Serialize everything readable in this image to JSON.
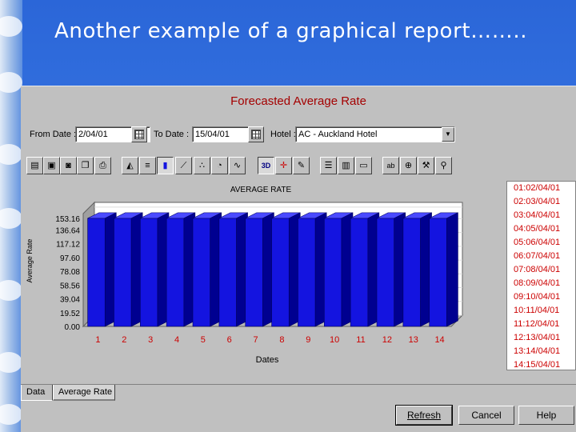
{
  "slide": {
    "title": "Another example of a graphical report…….."
  },
  "report": {
    "title": "Forecasted Average Rate",
    "from_label": "From Date :",
    "from_value": "2/04/01",
    "to_label": "To Date :",
    "to_value": "15/04/01",
    "hotel_label": "Hotel :",
    "hotel_value": "AC - Auckland Hotel"
  },
  "toolbar": {
    "icons": [
      "save-icon",
      "disk-icon",
      "camera-icon",
      "copy-icon",
      "print-icon",
      "area-chart-icon",
      "bar-horizontal-icon",
      "bar-chart-icon",
      "line-chart-icon",
      "scatter-icon",
      "pie-chart-icon",
      "trend-icon",
      "3d-icon",
      "crosshair-icon",
      "edit-points-icon",
      "text-icon",
      "columns-icon",
      "lines-icon",
      "label-icon",
      "zoom-icon",
      "tools-icon",
      "search-icon"
    ],
    "btn_3d": "3D",
    "btn_label": "ab"
  },
  "chart_data": {
    "type": "bar",
    "title": "AVERAGE RATE",
    "xlabel": "Dates",
    "ylabel": "Average Rate",
    "categories": [
      "1",
      "2",
      "3",
      "4",
      "5",
      "6",
      "7",
      "8",
      "9",
      "10",
      "11",
      "12",
      "13",
      "14"
    ],
    "y_ticks": [
      "153.16",
      "136.64",
      "117.12",
      "97.60",
      "78.08",
      "58.56",
      "39.04",
      "19.52",
      "0.00"
    ],
    "values": [
      153.16,
      153.16,
      153.16,
      153.16,
      153.16,
      153.16,
      153.16,
      153.16,
      153.16,
      153.16,
      153.16,
      153.16,
      153.16,
      153.16
    ],
    "ylim": [
      0,
      175.68
    ],
    "bar_color": "#1414e0",
    "axis_label_color": "#cc0000"
  },
  "date_list": [
    {
      "key": "01:",
      "val": "02/04/01"
    },
    {
      "key": "02:",
      "val": "03/04/01"
    },
    {
      "key": "03:",
      "val": "04/04/01"
    },
    {
      "key": "04:",
      "val": "05/04/01"
    },
    {
      "key": "05:",
      "val": "06/04/01"
    },
    {
      "key": "06:",
      "val": "07/04/01"
    },
    {
      "key": "07:",
      "val": "08/04/01"
    },
    {
      "key": "08:",
      "val": "09/04/01"
    },
    {
      "key": "09:",
      "val": "10/04/01"
    },
    {
      "key": "10:",
      "val": "11/04/01"
    },
    {
      "key": "11:",
      "val": "12/04/01"
    },
    {
      "key": "12:",
      "val": "13/04/01"
    },
    {
      "key": "13:",
      "val": "14/04/01"
    },
    {
      "key": "14:",
      "val": "15/04/01"
    }
  ],
  "tabs": {
    "data": "Data",
    "average_rate": "Average Rate"
  },
  "buttons": {
    "refresh": "Refresh",
    "cancel": "Cancel",
    "help": "Help"
  }
}
